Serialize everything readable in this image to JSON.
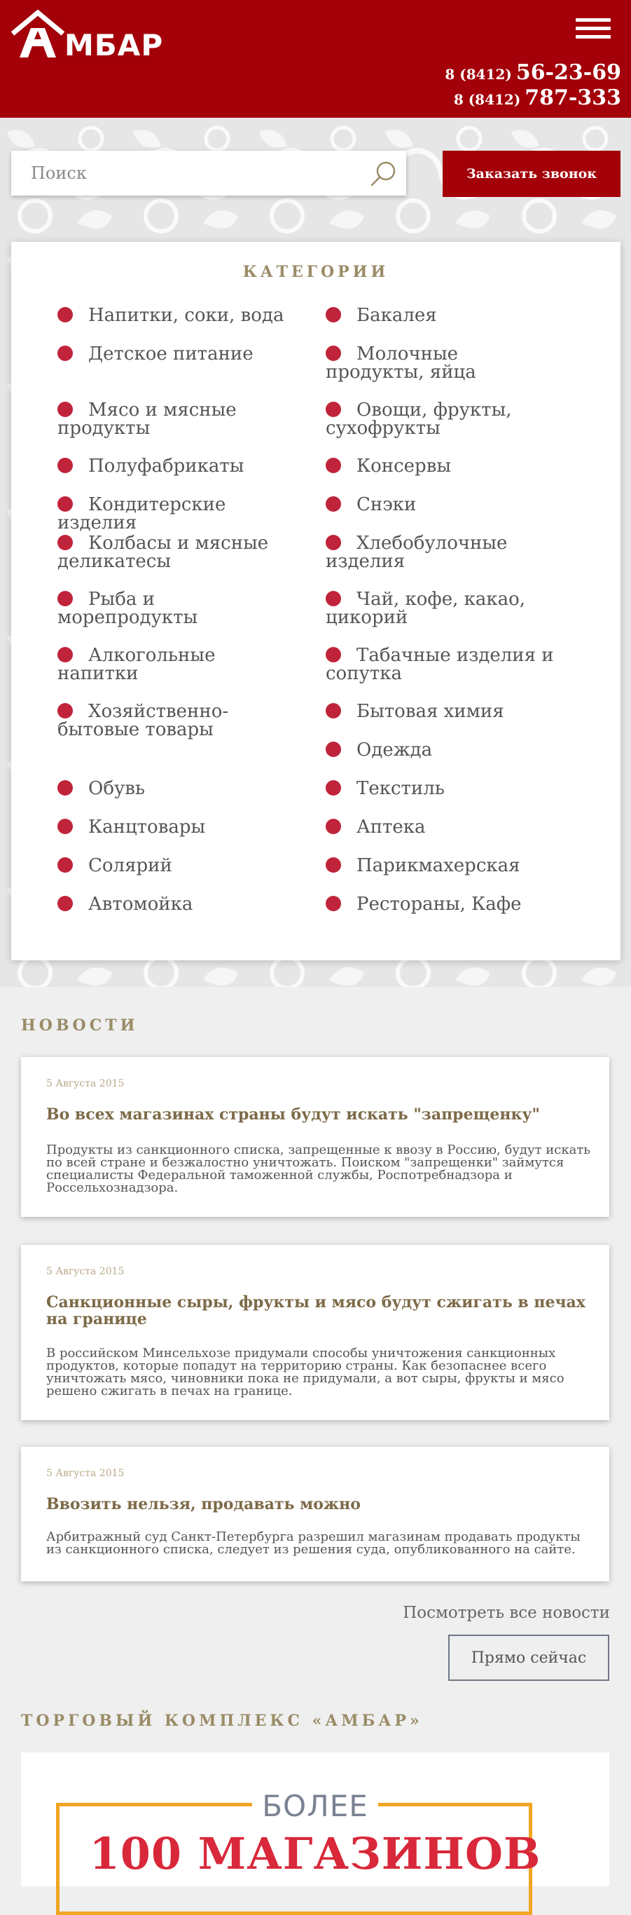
{
  "header": {
    "logo_text": "МБАР",
    "phones": [
      {
        "code": "8 (8412)",
        "number": "56-23-69"
      },
      {
        "code": "8 (8412)",
        "number": "787-333"
      }
    ]
  },
  "search": {
    "placeholder": "Поиск"
  },
  "callback_label": "Заказать звонок",
  "categories": {
    "title": "КАТЕГОРИИ",
    "left": [
      "Напитки, соки, вода",
      "Детское питание",
      "Мясо и мясные продукты",
      "Полуфабрикаты",
      "Кондитерские изделия",
      "Колбасы и мясные деликатесы",
      "Рыба и морепродукты",
      "Алкогольные напитки",
      "Хозяйственно-бытовые товары",
      "Обувь",
      "Канцтовары",
      "Солярий",
      "Автомойка"
    ],
    "right": [
      "Бакалея",
      "Молочные продукты, яйца",
      "Овощи, фрукты, сухофрукты",
      "Консервы",
      "Снэки",
      "Хлебобулочные изделия",
      "Чай, кофе, какао, цикорий",
      "Табачные изделия и сопутка",
      "Бытовая химия",
      "Одежда",
      "Текстиль",
      "Аптека",
      "Парикмахерская",
      "Рестораны, Кафе"
    ]
  },
  "news": {
    "title": "НОВОСТИ",
    "items": [
      {
        "date": "5 Августа 2015",
        "title": "Во всех магазинах страны будут искать \"запрещенку\"",
        "text": "Продукты из санкционного списка, запрещенные к ввозу в Россию, будут искать по всей стране и безжалостно уничтожать. Поиском \"запрещенки\" займутся специалисты Федеральной таможенной службы, Роспотребнадзора и Россельхознадзора."
      },
      {
        "date": "5 Августа 2015",
        "title": "Санкционные сыры, фрукты и мясо будут сжигать в печах на границе",
        "text": "В российском Минсельхозе придумали способы уничтожения санкционных продуктов, которые попадут на территорию страны. Как безопаснее всего уничтожать мясо, чиновники пока не придумали, а вот сыры, фрукты и мясо решено сжигать в печах на границе."
      },
      {
        "date": "5 Августа 2015",
        "title": "Ввозить нельзя, продавать можно",
        "text": "Арбитражный суд Санкт-Петербурга разрешил магазинам продавать продукты из санкционного списка, следует из решения суда, опубликованного на сайте."
      }
    ],
    "all_link": "Посмотреть все новости",
    "now_button": "Прямо сейчас"
  },
  "complex": {
    "title": "ТОРГОВЫЙ КОМПЛЕКС «АМБАР»",
    "promo_top": "БОЛЕЕ",
    "promo_main": "100 МАГАЗИНОВ"
  },
  "colors": {
    "brand_red": "#a30009",
    "bullet": "#c0243a",
    "accent_gold": "#9a8c67",
    "promo_orange": "#f0a623"
  }
}
